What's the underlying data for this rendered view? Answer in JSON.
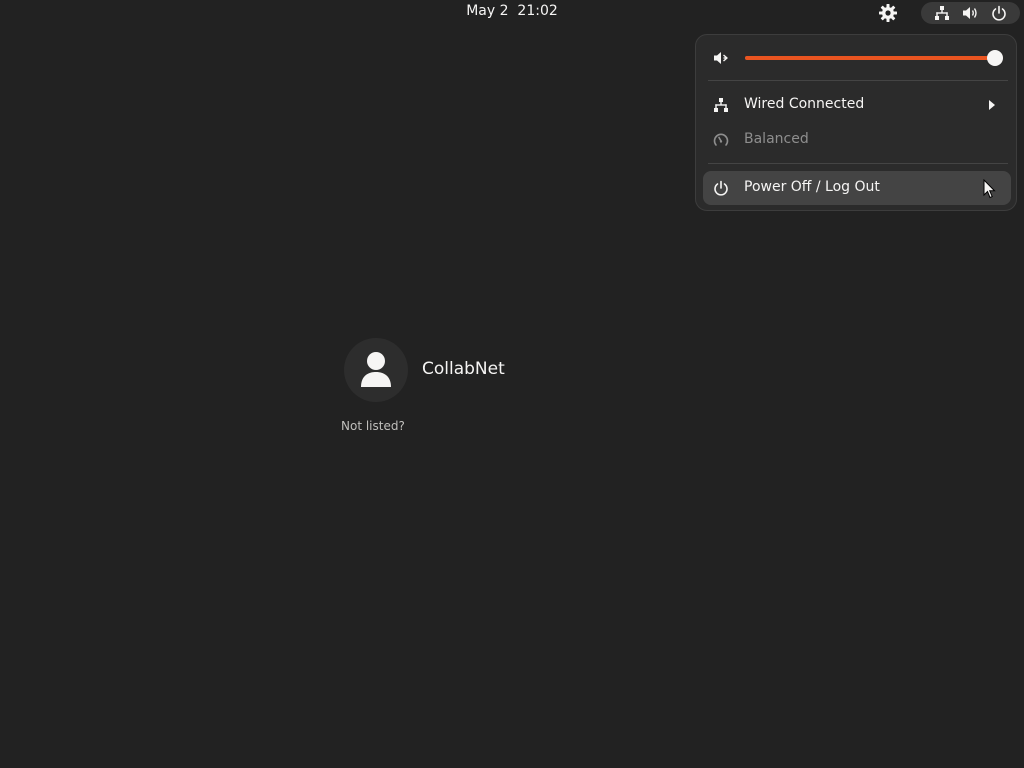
{
  "topbar": {
    "date": "May 2",
    "time": "21:02",
    "icons": [
      "gear-icon",
      "network-wired-icon",
      "volume-icon",
      "power-icon"
    ]
  },
  "quick_settings": {
    "volume": {
      "icon": "volume-muted-icon",
      "level": 1.0
    },
    "items": [
      {
        "label": "Wired Connected",
        "icon": "network-wired-icon",
        "has_submenu": true,
        "enabled": true
      },
      {
        "label": "Balanced",
        "icon": "power-profile-icon",
        "has_submenu": false,
        "enabled": false
      },
      {
        "label": "Power Off / Log Out",
        "icon": "power-icon",
        "has_submenu": true,
        "enabled": true,
        "highlighted": true
      }
    ]
  },
  "login": {
    "users": [
      {
        "name": "CollabNet",
        "avatar_icon": "user-avatar-icon"
      }
    ],
    "not_listed_label": "Not listed?"
  },
  "colors": {
    "background": "#222222",
    "accent": "#e95420",
    "popup_bg": "#2b2b2b",
    "highlight_bg": "#444444"
  }
}
